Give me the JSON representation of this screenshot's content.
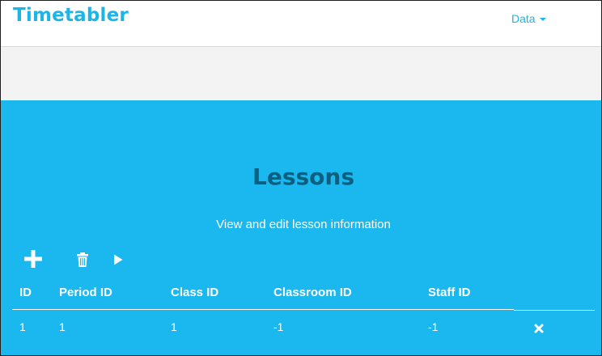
{
  "navbar": {
    "brand": "Timetabler",
    "menu_data_label": "Data"
  },
  "hero": {
    "title": "Lessons",
    "subtitle": "View and edit lesson information"
  },
  "toolbar": {
    "add_icon": "plus-icon",
    "delete_icon": "trash-icon",
    "run_icon": "play-icon"
  },
  "table": {
    "columns": [
      "ID",
      "Period ID",
      "Class ID",
      "Classroom ID",
      "Staff ID"
    ],
    "rows": [
      [
        "1",
        "1",
        "1",
        "-1",
        "-1"
      ]
    ],
    "row_action_icon": "close-icon"
  },
  "colors": {
    "brand": "#1cb5e8",
    "hero_background": "#1ab8ee",
    "title_text": "#0d5f7f",
    "grey_band": "#f3f3f3"
  }
}
